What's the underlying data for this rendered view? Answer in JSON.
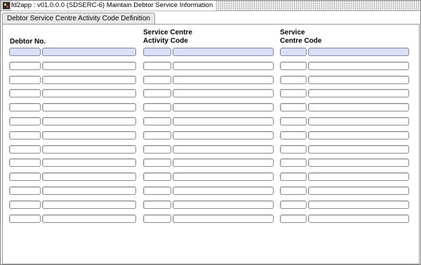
{
  "window": {
    "title": "fd2app : v01.0.0.0 (SDSERC-6) Maintain Debtor Service Information",
    "icon": "app-icon"
  },
  "tabs": [
    {
      "label": "Debtor Service Centre Activity Code Definition"
    }
  ],
  "columns": {
    "debtor": {
      "header": "Debtor No."
    },
    "activity": {
      "header": "Service Centre\nActivity Code"
    },
    "centre": {
      "header": "Service\nCentre Code"
    }
  },
  "rows": [
    {
      "active": true
    },
    {},
    {},
    {},
    {},
    {},
    {},
    {},
    {},
    {},
    {},
    {},
    {}
  ],
  "colors": {
    "active_field_bg": "#dde0f5",
    "field_border": "#8c8c8c"
  }
}
